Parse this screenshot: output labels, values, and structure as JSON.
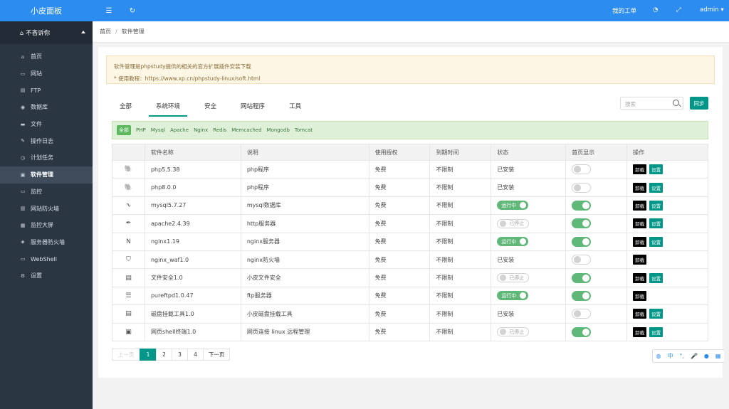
{
  "brand": "小皮面板",
  "user": "不吝诉你",
  "nav": [
    {
      "label": "首页",
      "icon": "home-icon",
      "glyph": "⌂"
    },
    {
      "label": "网站",
      "icon": "monitor-icon",
      "glyph": "▭"
    },
    {
      "label": "FTP",
      "icon": "ftp-icon",
      "glyph": "▤"
    },
    {
      "label": "数据库",
      "icon": "database-icon",
      "glyph": "◉"
    },
    {
      "label": "文件",
      "icon": "folder-icon",
      "glyph": "▬"
    },
    {
      "label": "操作日志",
      "icon": "log-icon",
      "glyph": "✎"
    },
    {
      "label": "计划任务",
      "icon": "clock-icon",
      "glyph": "◷"
    },
    {
      "label": "软件管理",
      "icon": "software-icon",
      "glyph": "▣"
    },
    {
      "label": "监控",
      "icon": "monitor-chart-icon",
      "glyph": "▭"
    },
    {
      "label": "网站防火墙",
      "icon": "firewall-icon",
      "glyph": "▥"
    },
    {
      "label": "监控大屏",
      "icon": "screen-icon",
      "glyph": "▦"
    },
    {
      "label": "服务器防火墙",
      "icon": "shield-icon",
      "glyph": "◈"
    },
    {
      "label": "WebShell",
      "icon": "terminal-icon",
      "glyph": "▭"
    },
    {
      "label": "设置",
      "icon": "gear-icon",
      "glyph": "⚙"
    }
  ],
  "topbar": {
    "workorder": "我的工单",
    "admin": "admin"
  },
  "breadcrumb": {
    "home": "首页",
    "current": "软件管理"
  },
  "notice": {
    "line1": "软件管理是phpstudy提供的相关的官方扩展插件安装下载",
    "line2": "* 使用教程：https://www.xp.cn/phpstudy-linux/soft.html"
  },
  "tabs": [
    "全部",
    "系统环境",
    "安全",
    "网站程序",
    "工具"
  ],
  "search": {
    "placeholder": "搜索"
  },
  "sync_label": "同步",
  "filters": [
    "全部",
    "PHP",
    "Mysql",
    "Apache",
    "Nginx",
    "Redis",
    "Memcached",
    "Mongodb",
    "Tomcat"
  ],
  "columns": [
    "软件名称",
    "说明",
    "使用授权",
    "到期时间",
    "状态",
    "首页显示",
    "操作"
  ],
  "rows": [
    {
      "name": "php5.5.38",
      "desc": "php程序",
      "license": "免费",
      "expire": "不限制",
      "status": "已安装",
      "status_type": "text",
      "home": false,
      "setting": true,
      "icon": "elephant-icon",
      "glyph": "🐘"
    },
    {
      "name": "php8.0.0",
      "desc": "php程序",
      "license": "免费",
      "expire": "不限制",
      "status": "已安装",
      "status_type": "text",
      "home": false,
      "setting": true,
      "icon": "elephant-icon",
      "glyph": "🐘"
    },
    {
      "name": "mysql5.7.27",
      "desc": "mysql数据库",
      "license": "免费",
      "expire": "不限制",
      "status": "运行中",
      "status_type": "on",
      "home": true,
      "setting": true,
      "icon": "dolphin-icon",
      "glyph": "∿"
    },
    {
      "name": "apache2.4.39",
      "desc": "http服务器",
      "license": "免费",
      "expire": "不限制",
      "status": "已停止",
      "status_type": "off",
      "home": true,
      "setting": true,
      "icon": "feather-icon",
      "glyph": "✒"
    },
    {
      "name": "nginx1.19",
      "desc": "nginx服务器",
      "license": "免费",
      "expire": "不限制",
      "status": "运行中",
      "status_type": "on",
      "home": true,
      "setting": true,
      "icon": "nginx-icon",
      "glyph": "N"
    },
    {
      "name": "nginx_waf1.0",
      "desc": "nginx防火墙",
      "license": "免费",
      "expire": "不限制",
      "status": "已安装",
      "status_type": "text",
      "home": false,
      "setting": false,
      "icon": "shield-icon",
      "glyph": "⛉"
    },
    {
      "name": "文件安全1.0",
      "desc": "小皮文件安全",
      "license": "免费",
      "expire": "不限制",
      "status": "已停止",
      "status_type": "off",
      "home": true,
      "setting": true,
      "icon": "file-lock-icon",
      "glyph": "▤"
    },
    {
      "name": "pureftpd1.0.47",
      "desc": "ftp服务器",
      "license": "免费",
      "expire": "不限制",
      "status": "运行中",
      "status_type": "on",
      "home": true,
      "setting": false,
      "icon": "server-icon",
      "glyph": "☰"
    },
    {
      "name": "磁盘挂载工具1.0",
      "desc": "小皮磁盘挂载工具",
      "license": "免费",
      "expire": "不限制",
      "status": "已安装",
      "status_type": "text",
      "home": false,
      "setting": true,
      "icon": "disk-icon",
      "glyph": "▤"
    },
    {
      "name": "网页shell终端1.0",
      "desc": "网页连接 linux 远程管理",
      "license": "免费",
      "expire": "不限制",
      "status": "已停止",
      "status_type": "off",
      "home": true,
      "setting": true,
      "icon": "terminal-icon",
      "glyph": "▣"
    }
  ],
  "actions": {
    "uninstall": "卸载",
    "setting": "设置"
  },
  "pager": {
    "prev": "上一页",
    "pages": [
      "1",
      "2",
      "3",
      "4"
    ],
    "next": "下一页",
    "current": "1"
  },
  "floatbar": {
    "lang": "中"
  }
}
